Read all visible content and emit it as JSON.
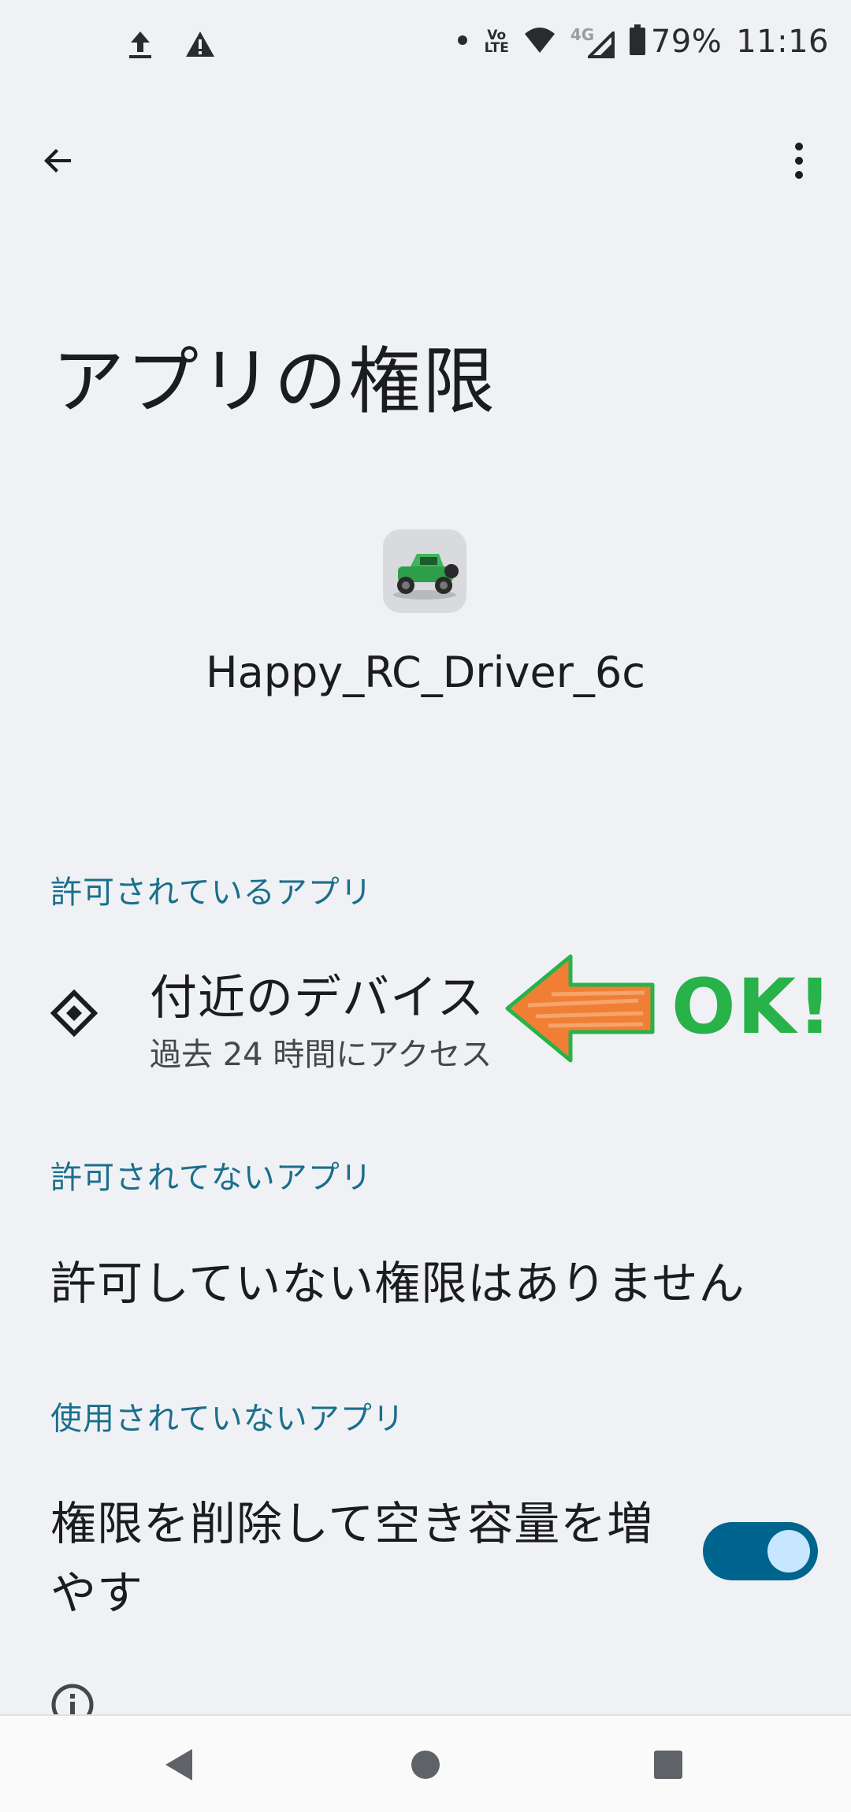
{
  "status_bar": {
    "battery": "79%",
    "time": "11:16",
    "icons": [
      "upload-icon",
      "warning-icon",
      "dot-icon",
      "volte-icon",
      "wifi-icon",
      "4g-icon",
      "signal-icon",
      "battery-icon"
    ],
    "volte_label_top": "Vo",
    "volte_label_bottom": "LTE",
    "network_label": "4G"
  },
  "appbar": {
    "back_icon": "arrow-back-icon",
    "menu_icon": "more-vert-icon"
  },
  "page": {
    "title": "アプリの権限",
    "app_name": "Happy_RC_Driver_6c"
  },
  "sections": {
    "allowed_header": "許可されているアプリ",
    "not_allowed_header": "許可されてないアプリ",
    "unused_header": "使用されていないアプリ"
  },
  "permission": {
    "title": "付近のデバイス",
    "subtitle": "過去 24 時間にアクセス",
    "icon": "nearby-devices-icon"
  },
  "annotation": {
    "label": "OK!",
    "arrow_color": "#f07f35",
    "text_color": "#27b24a"
  },
  "not_allowed": {
    "empty_text": "許可していない権限はありません"
  },
  "unused": {
    "toggle_label": "権限を削除して空き容量を増やす",
    "toggle_on": true
  },
  "colors": {
    "accent": "#00658e",
    "section_header": "#1a6f8c",
    "background": "#f0f1f4"
  }
}
